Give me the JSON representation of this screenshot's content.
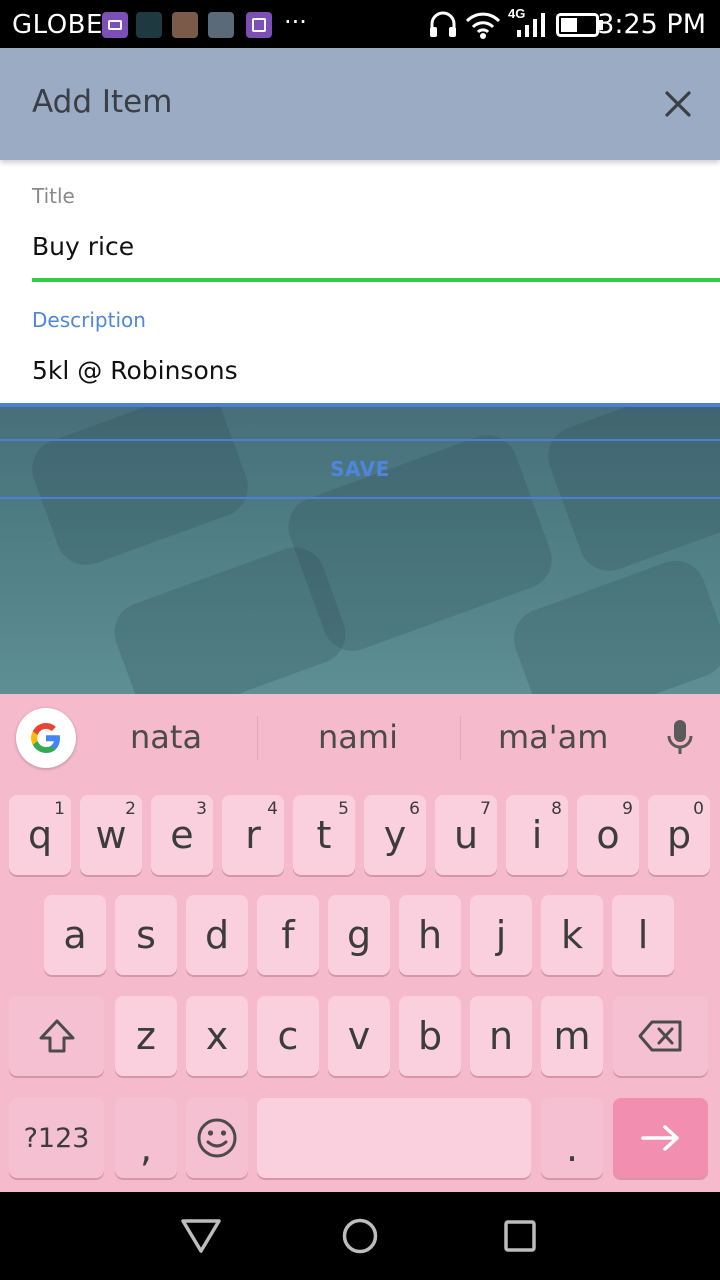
{
  "status_bar": {
    "carrier": "GLOBE",
    "more": "···",
    "network": "4G",
    "time": "3:25 PM"
  },
  "header": {
    "title": "Add Item",
    "close_icon": "close-icon"
  },
  "form": {
    "title_label": "Title",
    "title_value": "Buy rice",
    "description_label": "Description",
    "description_value": "5kl @ Robinsons"
  },
  "actions": {
    "save_label": "SAVE"
  },
  "keyboard": {
    "suggestions": [
      "nata",
      "nami",
      "ma'am"
    ],
    "row1": [
      {
        "k": "q",
        "h": "1"
      },
      {
        "k": "w",
        "h": "2"
      },
      {
        "k": "e",
        "h": "3"
      },
      {
        "k": "r",
        "h": "4"
      },
      {
        "k": "t",
        "h": "5"
      },
      {
        "k": "y",
        "h": "6"
      },
      {
        "k": "u",
        "h": "7"
      },
      {
        "k": "i",
        "h": "8"
      },
      {
        "k": "o",
        "h": "9"
      },
      {
        "k": "p",
        "h": "0"
      }
    ],
    "row2": [
      "a",
      "s",
      "d",
      "f",
      "g",
      "h",
      "j",
      "k",
      "l"
    ],
    "row3": [
      "z",
      "x",
      "c",
      "v",
      "b",
      "n",
      "m"
    ],
    "symbols_label": "?123",
    "comma": ",",
    "period": "."
  },
  "colors": {
    "header_bg": "#9aabc3",
    "title_underline": "#2ecc40",
    "description_accent": "#4f86dd",
    "keyboard_bg": "#f6bacd",
    "key_bg": "#fad0de",
    "enter_key_bg": "#f28fb0"
  }
}
